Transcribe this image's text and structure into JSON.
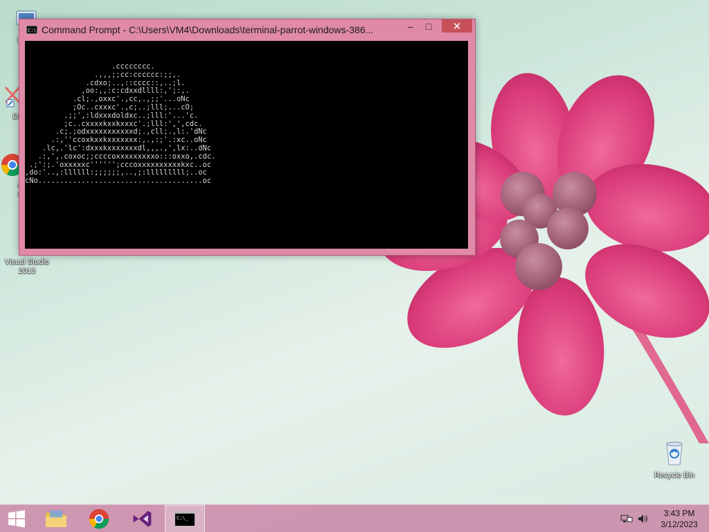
{
  "desktop": {
    "icons": [
      {
        "label": "My C",
        "icon": "computer-icon"
      },
      {
        "label": "Data",
        "icon": "data-shortcut-icon"
      },
      {
        "label": "G\nC",
        "icon": "chrome-shortcut-icon"
      },
      {
        "label": "Visual Studio 2013",
        "icon": "visual-studio-icon"
      }
    ],
    "recycle_bin": {
      "label": "Recycle Bin",
      "icon": "recycle-bin-icon"
    }
  },
  "window": {
    "title": "Command Prompt - C:\\Users\\VM4\\Downloads\\terminal-parrot-windows-386...",
    "minimize_symbol": "–",
    "maximize_symbol": "□",
    "close_symbol": "✕",
    "console_output": "                    .cccccccc.\n                .,,,;;cc:cccccc:;;,.\n              .cdxo;..,::cccc::,..;l.\n             ,oo:,,:c:cdxxdllll:,';:,.\n           .cl;.,oxxc'.,cc,.,;;'...oNc\n           ;Oc..cxxxc'.,c;..;lll;...cO;\n         .;;',:ldxxxdoldxc..;lll:'...'c.\n         ;c..cxxxxkxxkxxxc'.;lll:',',cdc.\n       .c;.;odxxxxxxxxxxxd;.,cll;.,l:.'dNc\n      .:,''ccoxkxxkxxxxxxx:,.,:;'.:xc..oNc\n    .lc,.'lc':dxxxkxxxxxxxdl,,,.,',lx:..dNc\n   .:,',.coxoc;;ccccoxxxxxxxxxo:::oxxo,.cdc.\n .;':;.'oxxxxxc'''''';cccoxxxxxxxxxxkxc..oc\n,do:'..,:llllll:;;;;;;,..,;:lllllllll;..oc\ncNo......................................oc"
  },
  "taskbar": {
    "start_icon": "windows-start-icon",
    "pinned": [
      {
        "name": "file-explorer",
        "icon": "folder-icon"
      },
      {
        "name": "chrome",
        "icon": "chrome-icon"
      },
      {
        "name": "visual-studio",
        "icon": "visual-studio-icon"
      },
      {
        "name": "command-prompt",
        "icon": "command-prompt-icon",
        "active": true
      }
    ],
    "tray": {
      "network_icon": "network-icon",
      "volume_icon": "volume-icon",
      "time": "3:43 PM",
      "date": "3/12/2023"
    }
  },
  "colors": {
    "window_frame": "#e08aa8",
    "close_button": "#c7505a",
    "console_bg": "#000000",
    "console_fg": "#d8d8d8",
    "taskbar": "#cb8aa8",
    "flower": "#e0467f"
  }
}
